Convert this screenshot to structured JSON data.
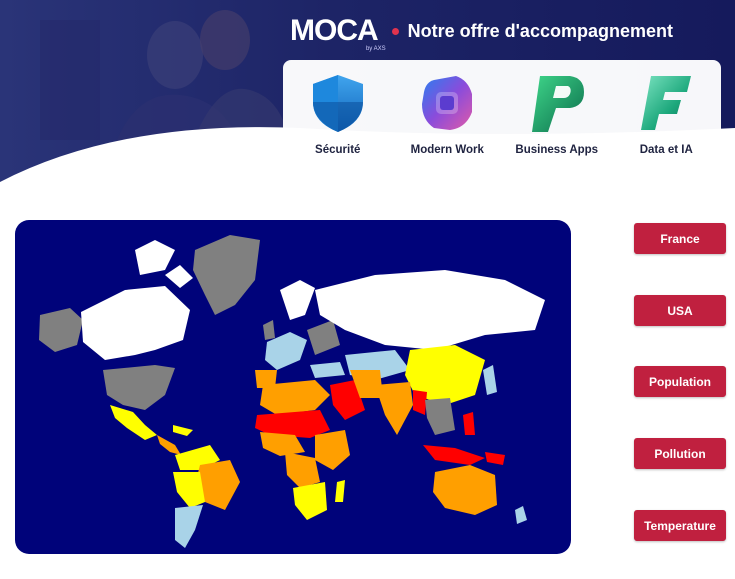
{
  "header": {
    "logo_text": "MOCA",
    "logo_sub": "by AXS",
    "tagline": "Notre offre d'accompagnement",
    "colors": {
      "banner": "#1b1f6b",
      "accent_dot": "#e0334e"
    }
  },
  "offers": [
    {
      "label": "Sécurité",
      "icon": "security-shield-icon"
    },
    {
      "label": "Modern Work",
      "icon": "microsoft-365-icon"
    },
    {
      "label": "Business Apps",
      "icon": "power-apps-icon"
    },
    {
      "label": "Data et IA",
      "icon": "fabric-icon"
    }
  ],
  "map": {
    "background": "#00037a",
    "category_colors": [
      "#ffffff",
      "#a9d3e8",
      "#ffff00",
      "#ff9f00",
      "#ff0000",
      "#808080"
    ]
  },
  "buttons": [
    {
      "label": "France"
    },
    {
      "label": "USA"
    },
    {
      "label": "Population"
    },
    {
      "label": "Pollution"
    },
    {
      "label": "Temperature"
    }
  ],
  "button_color": "#c0203f"
}
